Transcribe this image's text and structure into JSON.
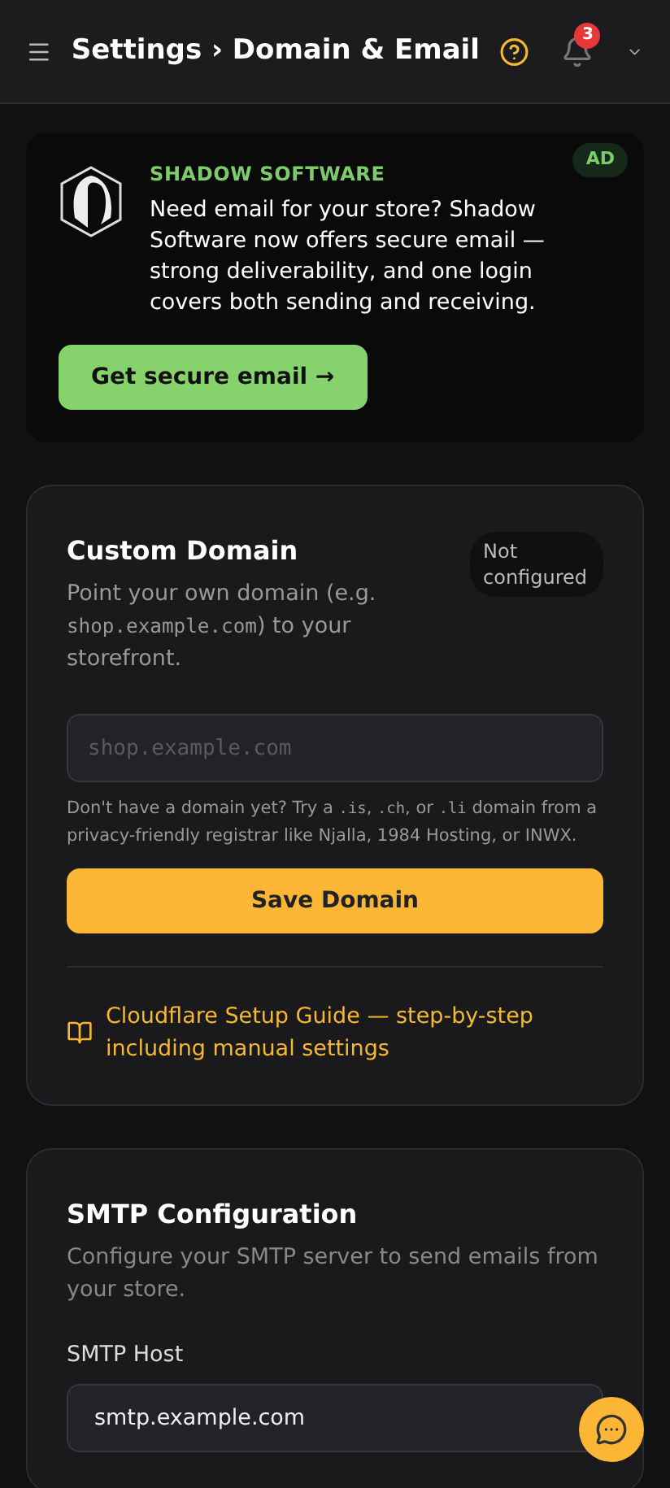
{
  "header": {
    "title": "Settings › Domain & Email",
    "notifications": "3"
  },
  "ad": {
    "badge": "AD",
    "brand": "SHADOW SOFTWARE",
    "text": "Need email for your store? Shadow Software now offers secure email — strong deliverability, and one login covers both sending and receiving.",
    "button": "Get secure email →"
  },
  "custom_domain": {
    "title": "Custom Domain",
    "status": "Not configured",
    "description": [
      {
        "kind": "text",
        "text": "Point your own domain (e.g. "
      },
      {
        "kind": "code",
        "text": "shop.example.com"
      },
      {
        "kind": "text",
        "text": ") to your storefront."
      }
    ],
    "input": {
      "placeholder": "shop.example.com"
    },
    "hint": [
      {
        "kind": "text",
        "text": "Don't have a domain yet? Try a "
      },
      {
        "kind": "code",
        "text": ".is"
      },
      {
        "kind": "text",
        "text": ", "
      },
      {
        "kind": "code",
        "text": ".ch"
      },
      {
        "kind": "text",
        "text": ", or "
      },
      {
        "kind": "code",
        "text": ".li"
      },
      {
        "kind": "text",
        "text": " domain from a privacy-friendly registrar like Njalla, 1984 Hosting, or INWX."
      }
    ],
    "button": "Save Domain",
    "guide_link": "Cloudflare Setup Guide — step-by-step including manual settings"
  },
  "smtp": {
    "title": "SMTP Configuration",
    "description": "Configure your SMTP server to send emails from your store.",
    "fields": [
      {
        "label": "SMTP Host",
        "value": "smtp.example.com"
      }
    ]
  }
}
